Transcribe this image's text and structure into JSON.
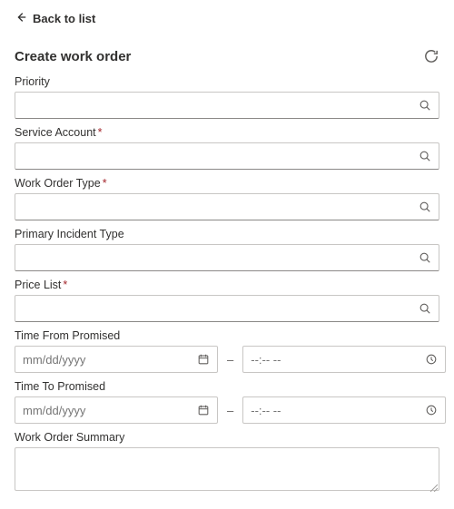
{
  "nav": {
    "back_label": "Back to list"
  },
  "header": {
    "title": "Create work order"
  },
  "fields": {
    "priority": {
      "label": "Priority",
      "value": ""
    },
    "service_account": {
      "label": "Service Account",
      "required": "*",
      "value": ""
    },
    "work_order_type": {
      "label": "Work Order Type",
      "required": "*",
      "value": ""
    },
    "primary_incident_type": {
      "label": "Primary Incident Type",
      "value": ""
    },
    "price_list": {
      "label": "Price List",
      "required": "*",
      "value": ""
    },
    "time_from": {
      "label": "Time From Promised",
      "date_placeholder": "mm/dd/yyyy",
      "time_placeholder": "--:-- --",
      "sep": "–"
    },
    "time_to": {
      "label": "Time To Promised",
      "date_placeholder": "mm/dd/yyyy",
      "time_placeholder": "--:-- --",
      "sep": "–"
    },
    "summary": {
      "label": "Work Order Summary",
      "value": ""
    }
  }
}
